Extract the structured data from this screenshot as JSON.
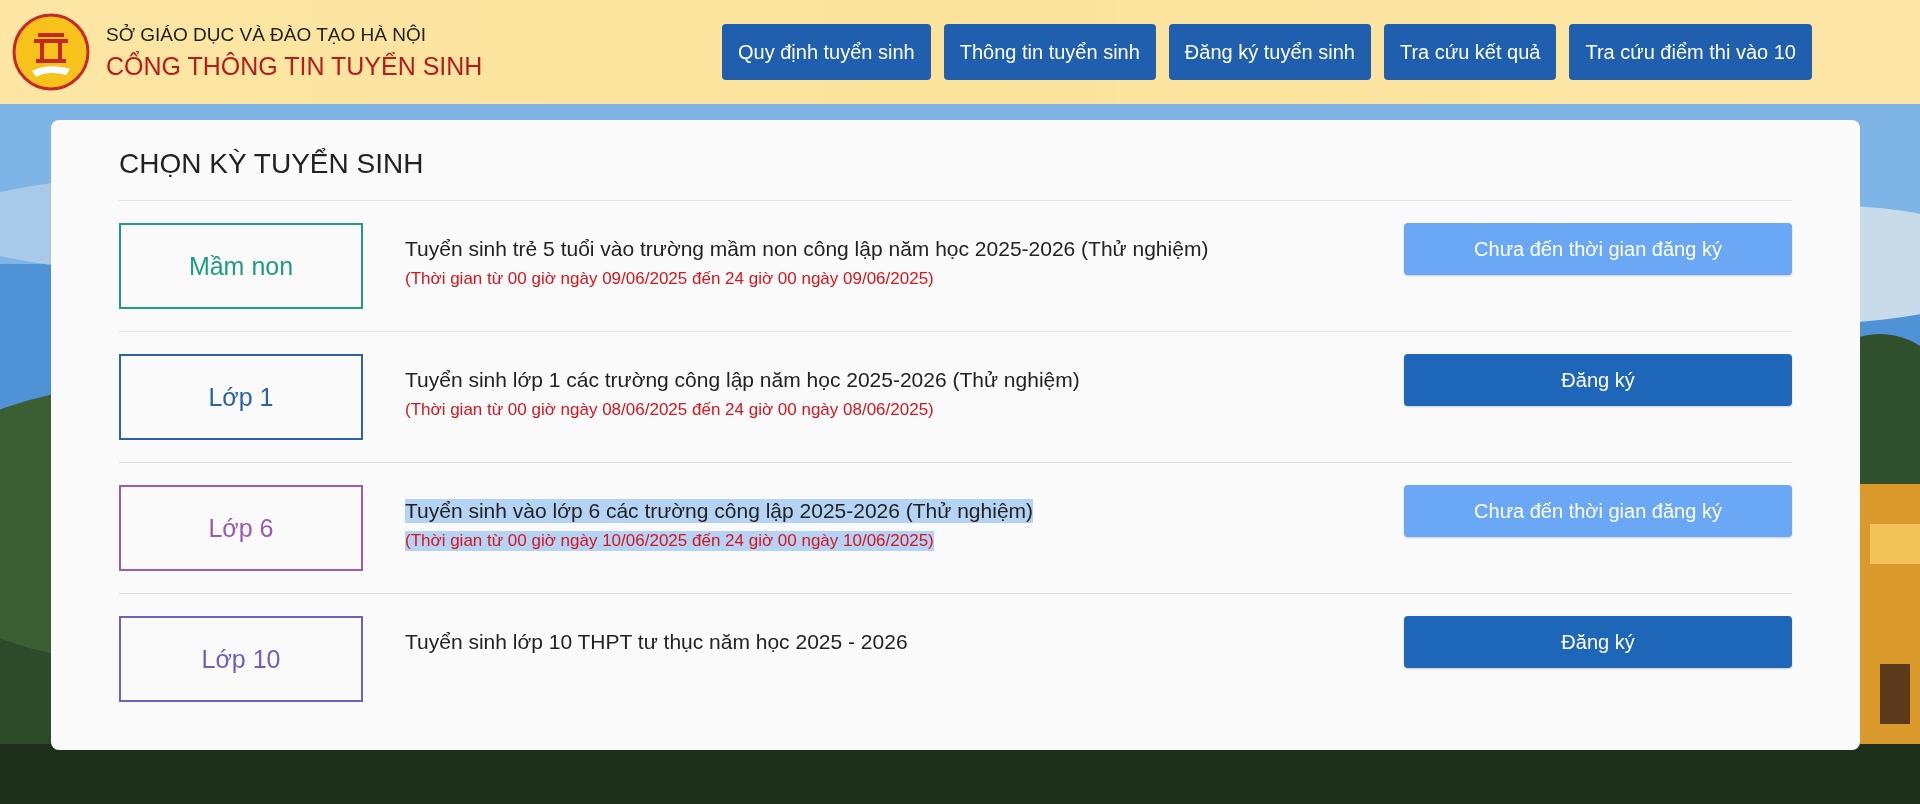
{
  "header": {
    "org": "SỞ GIÁO DỤC VÀ ĐÀO TẠO HÀ NỘI",
    "portal": "CỔNG THÔNG TIN TUYỂN SINH",
    "nav": [
      {
        "label": "Quy định tuyển sinh"
      },
      {
        "label": "Thông tin tuyển sinh"
      },
      {
        "label": "Đăng ký tuyển sinh"
      },
      {
        "label": "Tra cứu kết quả"
      },
      {
        "label": "Tra cứu điểm thi vào 10"
      }
    ]
  },
  "panel": {
    "title": "CHỌN KỲ TUYỂN SINH",
    "rows": [
      {
        "level": "Mầm non",
        "color": "#1e9e7e",
        "title": "Tuyển sinh trẻ 5 tuổi vào trường mầm non công lập năm học 2025-2026 (Thử nghiệm)",
        "period": "(Thời gian từ 00 giờ ngày 09/06/2025 đến 24 giờ 00 ngày 09/06/2025)",
        "button": "Chưa đến thời gian đăng ký",
        "disabled": true,
        "highlighted": false
      },
      {
        "level": "Lớp 1",
        "color": "#2a63a8",
        "title": "Tuyển sinh lớp 1 các trường công lập năm học 2025-2026 (Thử nghiệm)",
        "period": "(Thời gian từ 00 giờ ngày 08/06/2025 đến 24 giờ 00 ngày 08/06/2025)",
        "button": "Đăng ký",
        "disabled": false,
        "highlighted": false
      },
      {
        "level": "Lớp 6",
        "color": "#9b59b6",
        "title": "Tuyển sinh vào lớp 6 các trường công lập 2025-2026 (Thử nghiệm)",
        "period": "(Thời gian từ 00 giờ ngày 10/06/2025 đến 24 giờ 00 ngày 10/06/2025)",
        "button": "Chưa đến thời gian đăng ký",
        "disabled": true,
        "highlighted": true
      },
      {
        "level": "Lớp 10",
        "color": "#6f5fc0",
        "title": "Tuyển sinh lớp 10 THPT tư thục năm học 2025 - 2026",
        "button": "Đăng ký",
        "disabled": false,
        "highlighted": false
      }
    ]
  }
}
